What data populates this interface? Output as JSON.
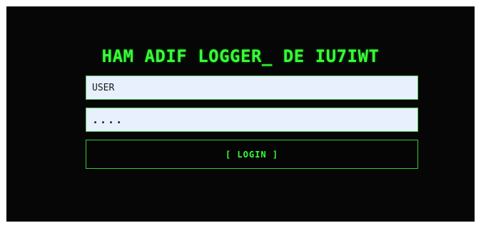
{
  "login": {
    "title": "HAM ADIF LOGGER_ DE IU7IWT",
    "username_value": "USER",
    "password_value": "....",
    "login_label": "[ LOGIN ]"
  },
  "colors": {
    "background": "#060606",
    "accent_green": "#37ff37",
    "field_background": "#e8f0fe"
  }
}
